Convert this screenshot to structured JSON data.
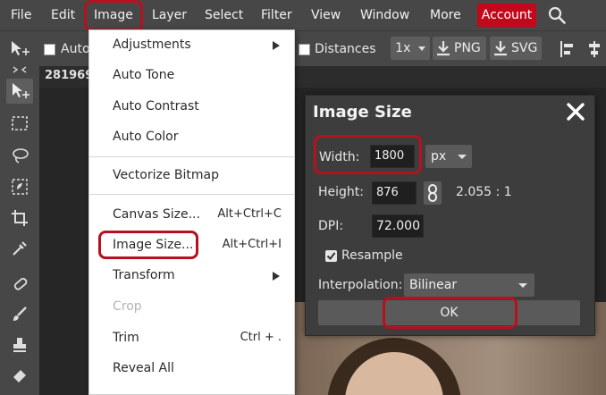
{
  "menubar": {
    "items": [
      "File",
      "Edit",
      "Image",
      "Layer",
      "Select",
      "Filter",
      "View",
      "Window",
      "More"
    ],
    "account_label": "Account",
    "account_color": "#c4081c"
  },
  "options_bar": {
    "auto_label": "Auto",
    "distances_label": "Distances",
    "zoom_label": "1x",
    "png_label": "PNG",
    "svg_label": "SVG"
  },
  "document": {
    "tab_title": "281969"
  },
  "image_menu": {
    "items": [
      {
        "label": "Adjustments",
        "has_submenu": true
      },
      {
        "label": "Auto Tone"
      },
      {
        "label": "Auto Contrast"
      },
      {
        "label": "Auto Color"
      },
      {
        "label": "Vectorize Bitmap"
      },
      {
        "label": "Canvas Size...",
        "shortcut": "Alt+Ctrl+C"
      },
      {
        "label": "Image Size...",
        "shortcut": "Alt+Ctrl+I"
      },
      {
        "label": "Transform",
        "has_submenu": true
      },
      {
        "label": "Crop",
        "disabled": true
      },
      {
        "label": "Trim",
        "shortcut": "Ctrl + ."
      },
      {
        "label": "Reveal All"
      }
    ]
  },
  "image_size_dialog": {
    "title": "Image Size",
    "width_label": "Width:",
    "width_value": "1800",
    "unit": "px",
    "height_label": "Height:",
    "height_value": "876",
    "ratio": "2.055 : 1",
    "dpi_label": "DPI:",
    "dpi_value": "72.000",
    "resample_label": "Resample",
    "resample_checked": true,
    "interpolation_label": "Interpolation:",
    "interpolation_value": "Bilinear",
    "ok_label": "OK"
  },
  "highlight_color": "#b5111f"
}
